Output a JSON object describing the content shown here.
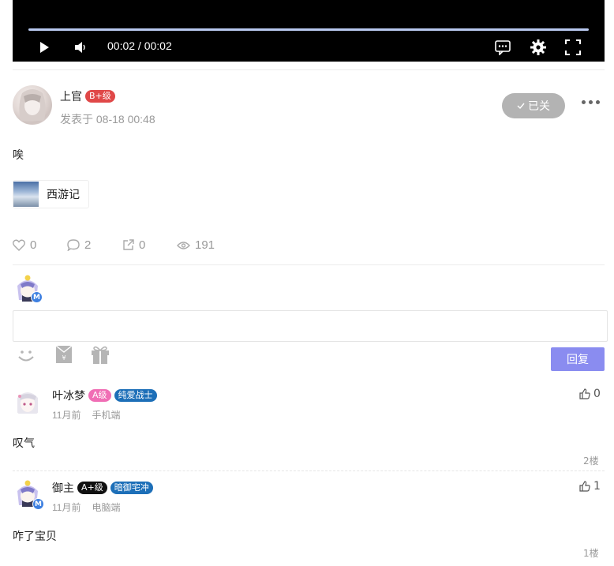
{
  "video": {
    "time": "00:02 / 00:02",
    "progress": 1.0
  },
  "post": {
    "author": "上官",
    "level": "B+级",
    "posted": "发表于 08-18 00:48",
    "status_button": "已关",
    "content": "唉",
    "tag": "西游记",
    "stats": {
      "likes": "0",
      "comments": "2",
      "shares": "0",
      "views": "191"
    }
  },
  "reply": {
    "button": "回复",
    "placeholder": ""
  },
  "comments": [
    {
      "author": "叶冰梦",
      "level": "A级",
      "badge": "纯爱战士",
      "time": "11月前",
      "device": "手机端",
      "content": "叹气",
      "likes": "0",
      "floor": "2楼"
    },
    {
      "author": "御主",
      "level": "A+级",
      "badge": "暗御宅冲",
      "time": "11月前",
      "device": "电脑端",
      "content": "咋了宝贝",
      "likes": "1",
      "floor": "1楼"
    }
  ],
  "colors": {
    "level_b": "#e04848",
    "level_a": "#f06eb5",
    "level_a_plus": "#111111",
    "badge_blue": "#1d6fb8",
    "reply_btn": "#8a8cf0",
    "closed_btn": "#b3b3b3"
  }
}
